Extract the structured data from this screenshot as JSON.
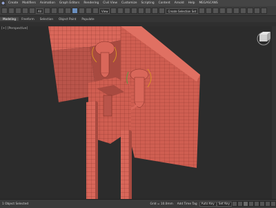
{
  "menubar": {
    "items": [
      "Create",
      "Modifiers",
      "Animation",
      "Graph Editors",
      "Rendering",
      "Civil View",
      "Customize",
      "Scripting",
      "Content",
      "Arnold",
      "Help",
      "MEGASCANS"
    ]
  },
  "toolbar": {
    "filter_value": "All",
    "view_value": "View",
    "selection_set_placeholder": "Create Selection Set"
  },
  "ribbon": {
    "tabs": [
      "Modeling",
      "Freeform",
      "Selection",
      "Object Paint",
      "Populate"
    ]
  },
  "viewport": {
    "label": "[+] [Perspective]",
    "model_color": "#d9675a",
    "wire_color": "#7a2a22"
  },
  "statusbar": {
    "selected": "1 Object Selected",
    "grid": "Grid = 10.0mm",
    "add_time_tag": "Add Time Tag",
    "auto_key": "Auto Key",
    "set_key": "Set Key"
  }
}
